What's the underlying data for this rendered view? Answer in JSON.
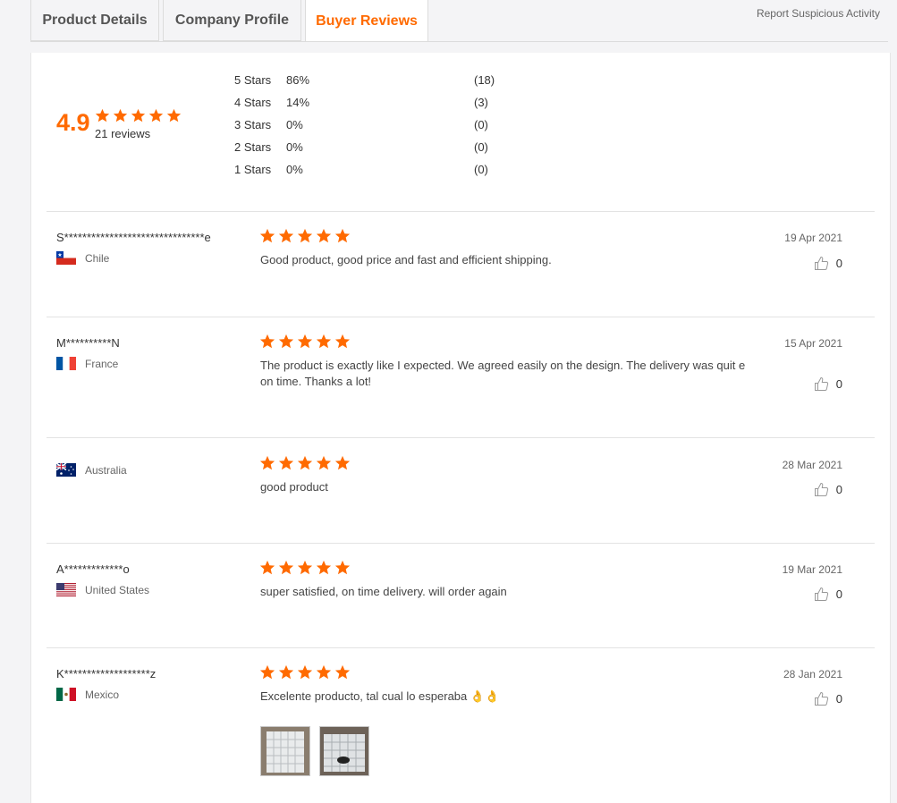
{
  "tabs": [
    {
      "label": "Product Details"
    },
    {
      "label": "Company Profile"
    },
    {
      "label": "Buyer Reviews"
    }
  ],
  "report_link": "Report Suspicious Activity",
  "summary": {
    "score": "4.9",
    "stars": 5,
    "reviews_label": "21 reviews",
    "distribution": [
      {
        "label": "5 Stars",
        "percent": "86%",
        "count": "(18)"
      },
      {
        "label": "4 Stars",
        "percent": "14%",
        "count": "(3)"
      },
      {
        "label": "3 Stars",
        "percent": "0%",
        "count": "(0)"
      },
      {
        "label": "2 Stars",
        "percent": "0%",
        "count": "(0)"
      },
      {
        "label": "1 Stars",
        "percent": "0%",
        "count": "(0)"
      }
    ]
  },
  "reviews": [
    {
      "name": "S*******************************e",
      "country": "Chile",
      "flag_icon": "chile-flag-icon",
      "rating": 5,
      "text": "Good product, good price and fast and efficient shipping.",
      "date": "19 Apr 2021",
      "likes": "0"
    },
    {
      "name": "M**********N",
      "country": "France",
      "flag_icon": "france-flag-icon",
      "rating": 5,
      "text": "The product is exactly like I expected. We agreed easily on the design. The delivery was quit e on time. Thanks a lot!",
      "date": "15 Apr 2021",
      "likes": "0"
    },
    {
      "name": "",
      "country": "Australia",
      "flag_icon": "australia-flag-icon",
      "rating": 5,
      "text": "good product",
      "date": "28 Mar 2021",
      "likes": "0"
    },
    {
      "name": "A*************o",
      "country": "United States",
      "flag_icon": "usa-flag-icon",
      "rating": 5,
      "text": "super satisfied, on time delivery. will order again",
      "date": "19 Mar 2021",
      "likes": "0"
    },
    {
      "name": "K*******************z",
      "country": "Mexico",
      "flag_icon": "mexico-flag-icon",
      "rating": 5,
      "text": "Excelente producto, tal cual lo esperaba 👌👌",
      "date": "28 Jan 2021",
      "likes": "0"
    }
  ],
  "colors": {
    "accent": "#ff6a00",
    "star": "#ff6a00",
    "text": "#333333",
    "muted": "#666666"
  }
}
